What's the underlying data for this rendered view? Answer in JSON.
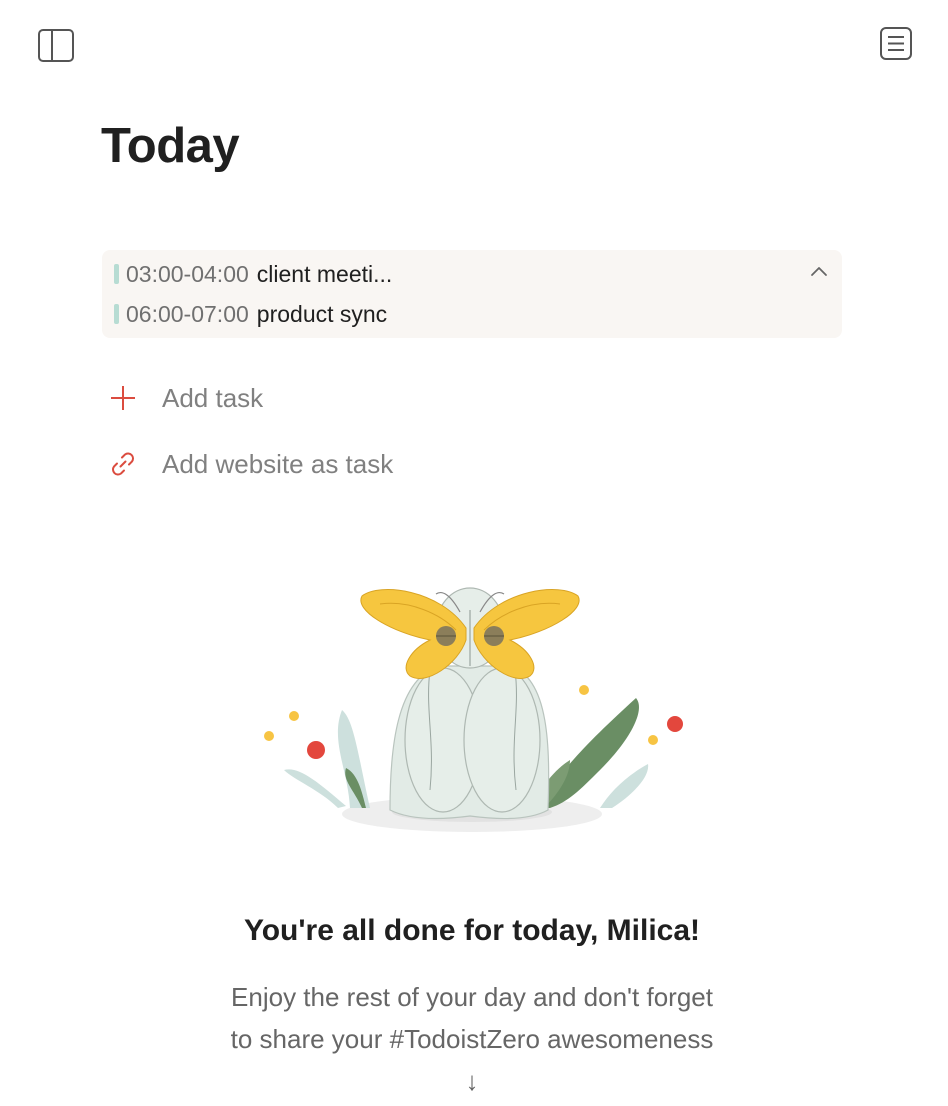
{
  "topbar": {
    "sidebar_toggle_icon": "sidebar-panel-icon",
    "view_options_icon": "view-options-icon"
  },
  "header": {
    "title": "Today"
  },
  "calendar_events": {
    "bar_color": "#b7dcd3",
    "collapse_icon": "chevron-up-icon",
    "items": [
      {
        "time": "03:00-04:00",
        "title": "client meeti..."
      },
      {
        "time": "06:00-07:00",
        "title": "product sync"
      }
    ]
  },
  "actions": {
    "add_task_label": "Add task",
    "add_task_icon": "plus-icon",
    "add_website_label": "Add website as task",
    "add_website_icon": "link-icon",
    "accent_color": "#db4c3f"
  },
  "empty_state": {
    "illustration": "meditating-figure-with-butterfly-illustration",
    "title": "You're all done for today, Milica!",
    "body": "Enjoy the rest of your day and don't forget to share your #TodoistZero awesomeness ↓"
  }
}
